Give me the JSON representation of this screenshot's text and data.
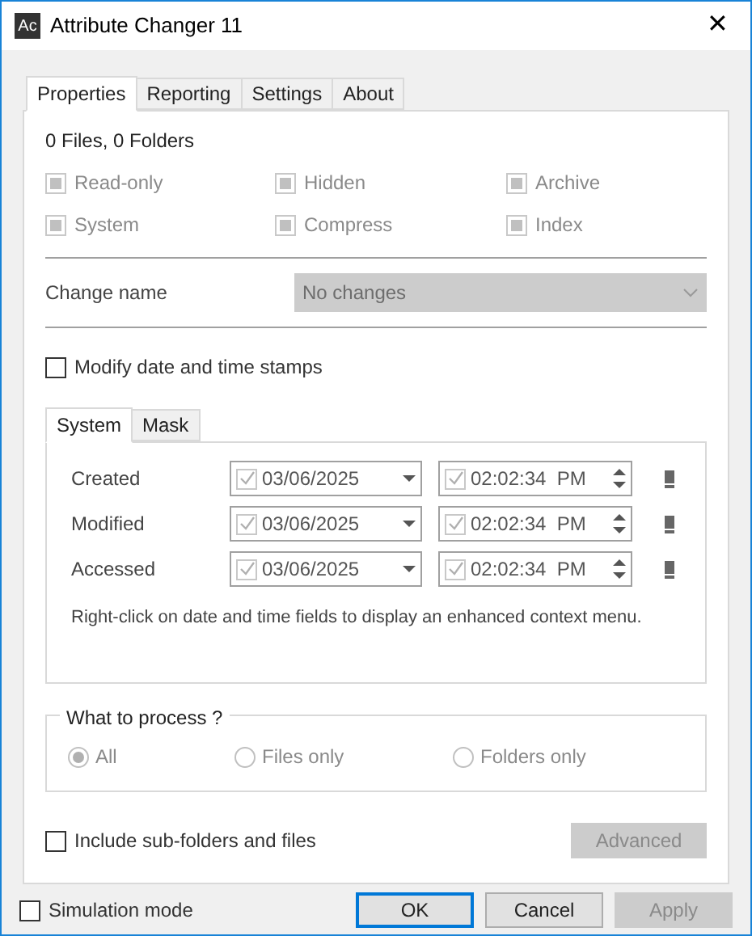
{
  "window": {
    "title": "Attribute Changer 11",
    "icon_text": "Ac",
    "close": "✕"
  },
  "tabs": [
    {
      "label": "Properties",
      "selected": true
    },
    {
      "label": "Reporting",
      "selected": false
    },
    {
      "label": "Settings",
      "selected": false
    },
    {
      "label": "About",
      "selected": false
    }
  ],
  "summary": "0 Files, 0 Folders",
  "attributes": [
    {
      "label": "Read-only",
      "indeterminate": true,
      "disabled": true
    },
    {
      "label": "Hidden",
      "indeterminate": true,
      "disabled": true
    },
    {
      "label": "Archive",
      "indeterminate": true,
      "disabled": true
    },
    {
      "label": "System",
      "indeterminate": true,
      "disabled": true
    },
    {
      "label": "Compress",
      "indeterminate": true,
      "disabled": true
    },
    {
      "label": "Index",
      "indeterminate": true,
      "disabled": true
    }
  ],
  "change_name": {
    "label": "Change name",
    "value": "No changes",
    "disabled": true
  },
  "modify_stamps": {
    "label": "Modify date and time stamps",
    "checked": false
  },
  "stamp_tabs": [
    {
      "label": "System",
      "selected": true
    },
    {
      "label": "Mask",
      "selected": false
    }
  ],
  "stamps": [
    {
      "label": "Created",
      "date": "03/06/2025",
      "date_checked": true,
      "time": "02:02:34  PM",
      "time_checked": true
    },
    {
      "label": "Modified",
      "date": "03/06/2025",
      "date_checked": true,
      "time": "02:02:34  PM",
      "time_checked": true
    },
    {
      "label": "Accessed",
      "date": "03/06/2025",
      "date_checked": true,
      "time": "02:02:34  PM",
      "time_checked": true
    }
  ],
  "stamp_note": "Right-click on date and time fields to display an enhanced context menu.",
  "what_to_process": {
    "legend": "What to process ?",
    "options": [
      {
        "label": "All",
        "selected": true,
        "disabled": true
      },
      {
        "label": "Files only",
        "selected": false,
        "disabled": true
      },
      {
        "label": "Folders only",
        "selected": false,
        "disabled": true
      }
    ]
  },
  "include_subfolders": {
    "label": "Include sub-folders and files",
    "checked": false
  },
  "advanced_button": {
    "label": "Advanced",
    "disabled": true
  },
  "simulation_mode": {
    "label": "Simulation mode",
    "checked": false
  },
  "buttons": [
    {
      "label": "OK",
      "kind": "default",
      "disabled": false
    },
    {
      "label": "Cancel",
      "kind": "normal",
      "disabled": false
    },
    {
      "label": "Apply",
      "kind": "normal",
      "disabled": true
    }
  ]
}
